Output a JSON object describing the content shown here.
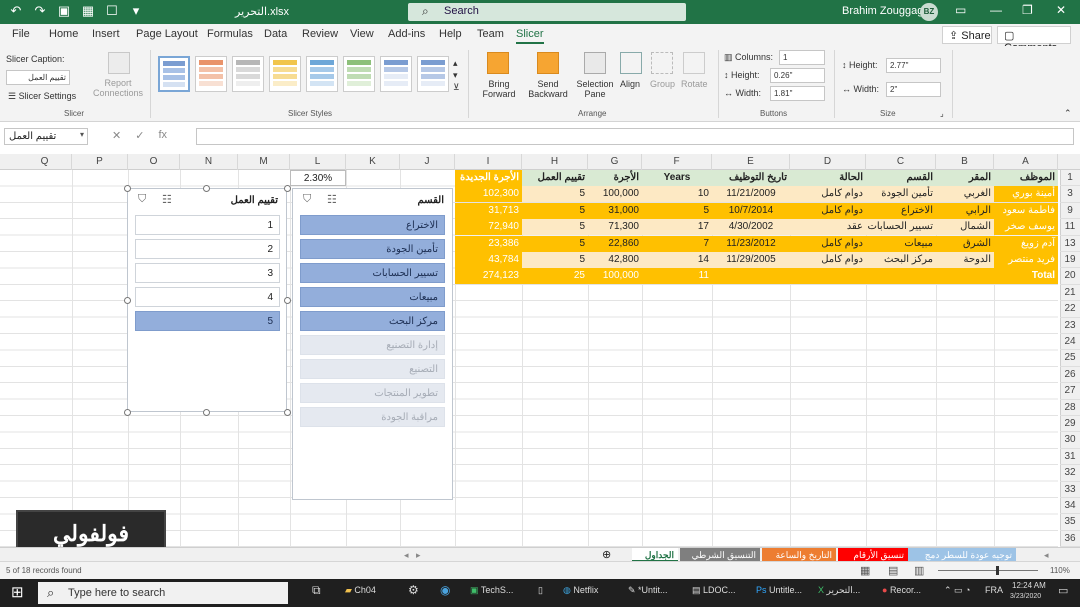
{
  "titlebar": {
    "document_title": "التحرير.xlsx",
    "search_placeholder": "Search",
    "user_name": "Brahim Zouggagh",
    "user_initials": "BZ"
  },
  "tabs": {
    "items": [
      "File",
      "Home",
      "Insert",
      "Page Layout",
      "Formulas",
      "Data",
      "Review",
      "View",
      "Add-ins",
      "Help",
      "Team",
      "Slicer"
    ],
    "active": "Slicer",
    "share_label": "Share",
    "comments_label": "Comments"
  },
  "ribbon": {
    "slicer_caption_label": "Slicer Caption:",
    "slicer_caption_value": "تقييم العمل",
    "slicer_settings_label": "Slicer Settings",
    "report_connections_label": "Report Connections",
    "group_slicer": "Slicer",
    "group_slicer_styles": "Slicer Styles",
    "bring_forward": "Bring Forward",
    "send_backward": "Send Backward",
    "selection_pane": "Selection Pane",
    "align": "Align",
    "group": "Group",
    "rotate": "Rotate",
    "group_arrange": "Arrange",
    "columns_label": "Columns:",
    "columns_value": "1",
    "btn_height_label": "Height:",
    "btn_height_value": "0.26\"",
    "btn_width_label": "Width:",
    "btn_width_value": "1.81\"",
    "group_buttons": "Buttons",
    "size_height_label": "Height:",
    "size_height_value": "2.77\"",
    "size_width_label": "Width:",
    "size_width_value": "2\"",
    "group_size": "Size"
  },
  "formula_bar": {
    "name_box": "تقييم العمل",
    "fx_label": "fx"
  },
  "columns": [
    "A",
    "B",
    "C",
    "D",
    "E",
    "F",
    "G",
    "H",
    "I",
    "J",
    "K",
    "L",
    "M",
    "N",
    "O",
    "P",
    "Q"
  ],
  "rows": [
    "1",
    "3",
    "9",
    "11",
    "13",
    "19",
    "20",
    "21",
    "22",
    "23",
    "24",
    "25",
    "26",
    "27",
    "28",
    "29",
    "30",
    "31",
    "32",
    "33",
    "34",
    "35",
    "36"
  ],
  "cell_L_above": "2.30%",
  "table": {
    "headers": [
      "الموظف",
      "المقر",
      "القسم",
      "الحالة",
      "تاريخ التوظيف",
      "Years",
      "الأجرة",
      "تقييم العمل",
      "الأجرة الجديدة"
    ],
    "rows": [
      [
        "أمينة بوري",
        "الغربي",
        "تأمين الجودة",
        "دوام كامل",
        "11/21/2009",
        "10",
        "100,000",
        "5",
        "102,300"
      ],
      [
        "فاطمة سعود",
        "الرابي",
        "الاختراع",
        "دوام كامل",
        "10/7/2014",
        "5",
        "31,000",
        "5",
        "31,713"
      ],
      [
        "يوسف صخر",
        "الشمال",
        "تسيير الحسابات",
        "عقد",
        "4/30/2002",
        "17",
        "71,300",
        "5",
        "72,940"
      ],
      [
        "آدم زويغ",
        "الشرق",
        "مبيعات",
        "دوام كامل",
        "11/23/2012",
        "7",
        "22,860",
        "5",
        "23,386"
      ],
      [
        "فريد منتصر",
        "الدوحة",
        "مركز البحث",
        "دوام كامل",
        "11/29/2005",
        "14",
        "42,800",
        "5",
        "43,784"
      ]
    ],
    "total": [
      "Total",
      "",
      "",
      "",
      "",
      "11",
      "100,000",
      "25",
      "274,123"
    ]
  },
  "slicer_rating": {
    "title": "تقييم العمل",
    "items": [
      "1",
      "2",
      "3",
      "4",
      "5"
    ],
    "selected": "5"
  },
  "slicer_department": {
    "title": "القسم",
    "selected_items": [
      "الاختراع",
      "تأمين الجودة",
      "تسيير الحسابات",
      "مبيعات",
      "مركز البحث"
    ],
    "unavailable_items": [
      "إدارة التصنيع",
      "التصنيع",
      "تطوير المنتجات",
      "مراقبة الجودة"
    ]
  },
  "sheet_tabs": [
    {
      "label": "توجيه عودة للسطر دمج",
      "color": "#9dc3e6"
    },
    {
      "label": "تنسيق الأرقام",
      "color": "#ff0000"
    },
    {
      "label": "التاريخ والساعة",
      "color": "#ed7d31"
    },
    {
      "label": "التنسيق الشرطي",
      "color": "#7f7f7f"
    },
    {
      "label": "الجداول",
      "color": "#ffffff"
    }
  ],
  "status": {
    "left_text": "5 of 18 records found",
    "zoom": "110%"
  },
  "taskbar": {
    "search_placeholder": "Type here to search",
    "items": [
      "Ch04",
      "TechS...",
      "Netflix",
      "*Untit...",
      "LDOC...",
      "Untitle...",
      "التحرير...",
      "Recor..."
    ],
    "lang": "FRA",
    "time": "12:24 AM",
    "date": "3/23/2020"
  },
  "watermark": "فولفولي",
  "colors": {
    "excel_green": "#217346",
    "header_row": "#d9ead3",
    "row_light": "#fde9c4",
    "row_orange": "#ffc000",
    "total_row": "#ffc000",
    "slicer_selected": "#93aedb"
  }
}
